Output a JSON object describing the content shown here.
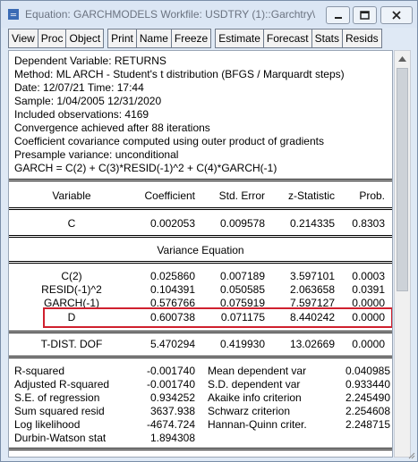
{
  "window": {
    "title": "Equation: GARCHMODELS   Workfile: USDTRY (1)::Garchtry\\"
  },
  "toolbar": {
    "buttons": [
      "View",
      "Proc",
      "Object",
      "Print",
      "Name",
      "Freeze",
      "Estimate",
      "Forecast",
      "Stats",
      "Resids"
    ]
  },
  "header": {
    "lines": [
      "Dependent Variable: RETURNS",
      "Method: ML ARCH - Student's t distribution (BFGS / Marquardt steps)",
      "Date: 12/07/21   Time: 17:44",
      "Sample: 1/04/2005 12/31/2020",
      "Included observations: 4169",
      "Convergence achieved after 88 iterations",
      "Coefficient covariance computed using outer product of gradients",
      "Presample variance: unconditional",
      "GARCH = C(2) + C(3)*RESID(-1)^2 + C(4)*GARCH(-1)"
    ]
  },
  "table": {
    "columns": [
      "Variable",
      "Coefficient",
      "Std. Error",
      "z-Statistic",
      "Prob."
    ],
    "mean_rows": [
      [
        "C",
        "0.002053",
        "0.009578",
        "0.214335",
        "0.8303"
      ]
    ],
    "variance_title": "Variance Equation",
    "variance_rows": [
      [
        "C(2)",
        "0.025860",
        "0.007189",
        "3.597101",
        "0.0003"
      ],
      [
        "RESID(-1)^2",
        "0.104391",
        "0.050585",
        "2.063658",
        "0.0391"
      ],
      [
        "GARCH(-1)",
        "0.576766",
        "0.075919",
        "7.597127",
        "0.0000"
      ],
      [
        "D",
        "0.600738",
        "0.071175",
        "8.440242",
        "0.0000"
      ]
    ],
    "dist_rows": [
      [
        "T-DIST. DOF",
        "5.470294",
        "0.419930",
        "13.02669",
        "0.0000"
      ]
    ]
  },
  "stats": {
    "left": [
      [
        "R-squared",
        "-0.001740"
      ],
      [
        "Adjusted R-squared",
        "-0.001740"
      ],
      [
        "S.E. of regression",
        "0.934252"
      ],
      [
        "Sum squared resid",
        "3637.938"
      ],
      [
        "Log likelihood",
        "-4674.724"
      ],
      [
        "Durbin-Watson stat",
        "1.894308"
      ]
    ],
    "right": [
      [
        "Mean dependent var",
        "0.040985"
      ],
      [
        "S.D. dependent var",
        "0.933440"
      ],
      [
        "Akaike info criterion",
        "2.245490"
      ],
      [
        "Schwarz criterion",
        "2.254608"
      ],
      [
        "Hannan-Quinn criter.",
        "2.248715"
      ]
    ]
  },
  "colors": {
    "highlight": "#d0202e",
    "window_bg": "#dfe9f5"
  }
}
